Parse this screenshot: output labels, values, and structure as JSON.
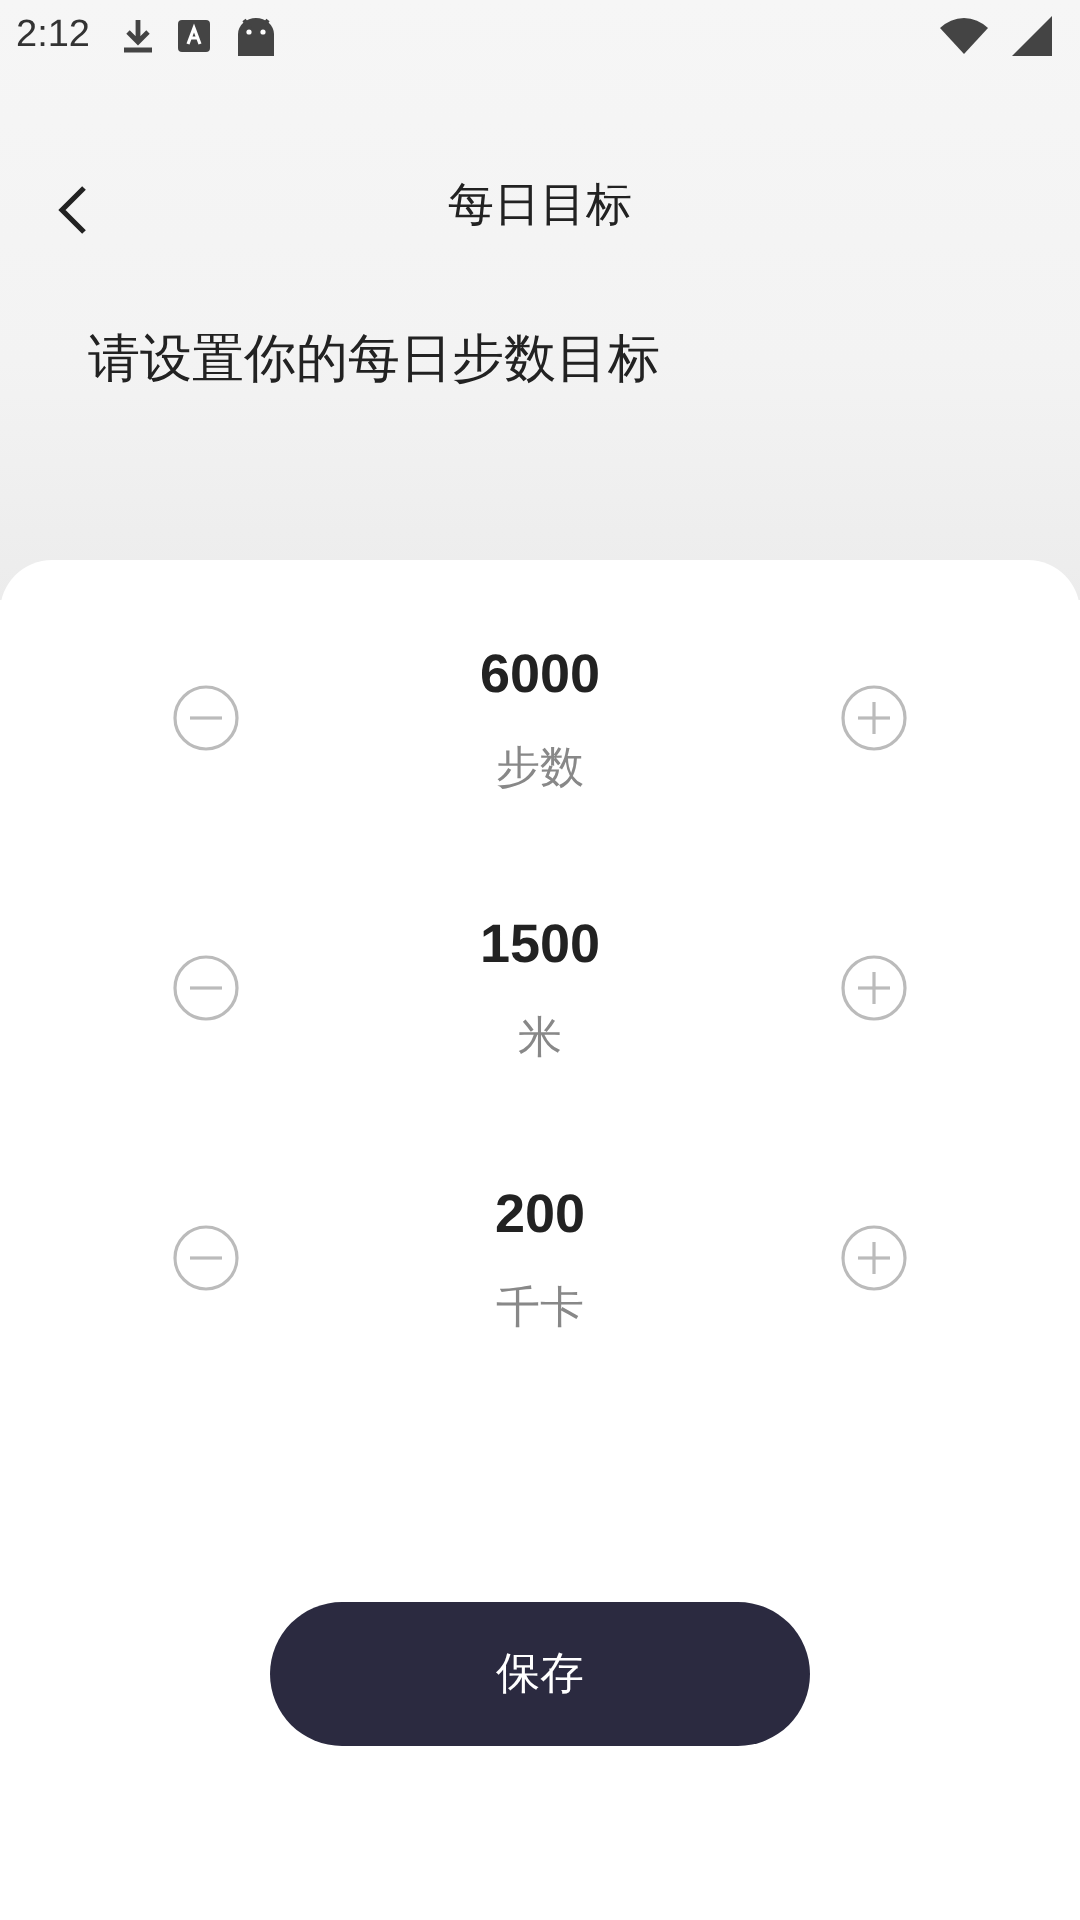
{
  "status_bar": {
    "time": "2:12"
  },
  "header": {
    "title": "每日目标"
  },
  "prompt": "请设置你的每日步数目标",
  "goals": [
    {
      "value": "6000",
      "unit": "步数"
    },
    {
      "value": "1500",
      "unit": "米"
    },
    {
      "value": "200",
      "unit": "千卡"
    }
  ],
  "save_button": "保存"
}
